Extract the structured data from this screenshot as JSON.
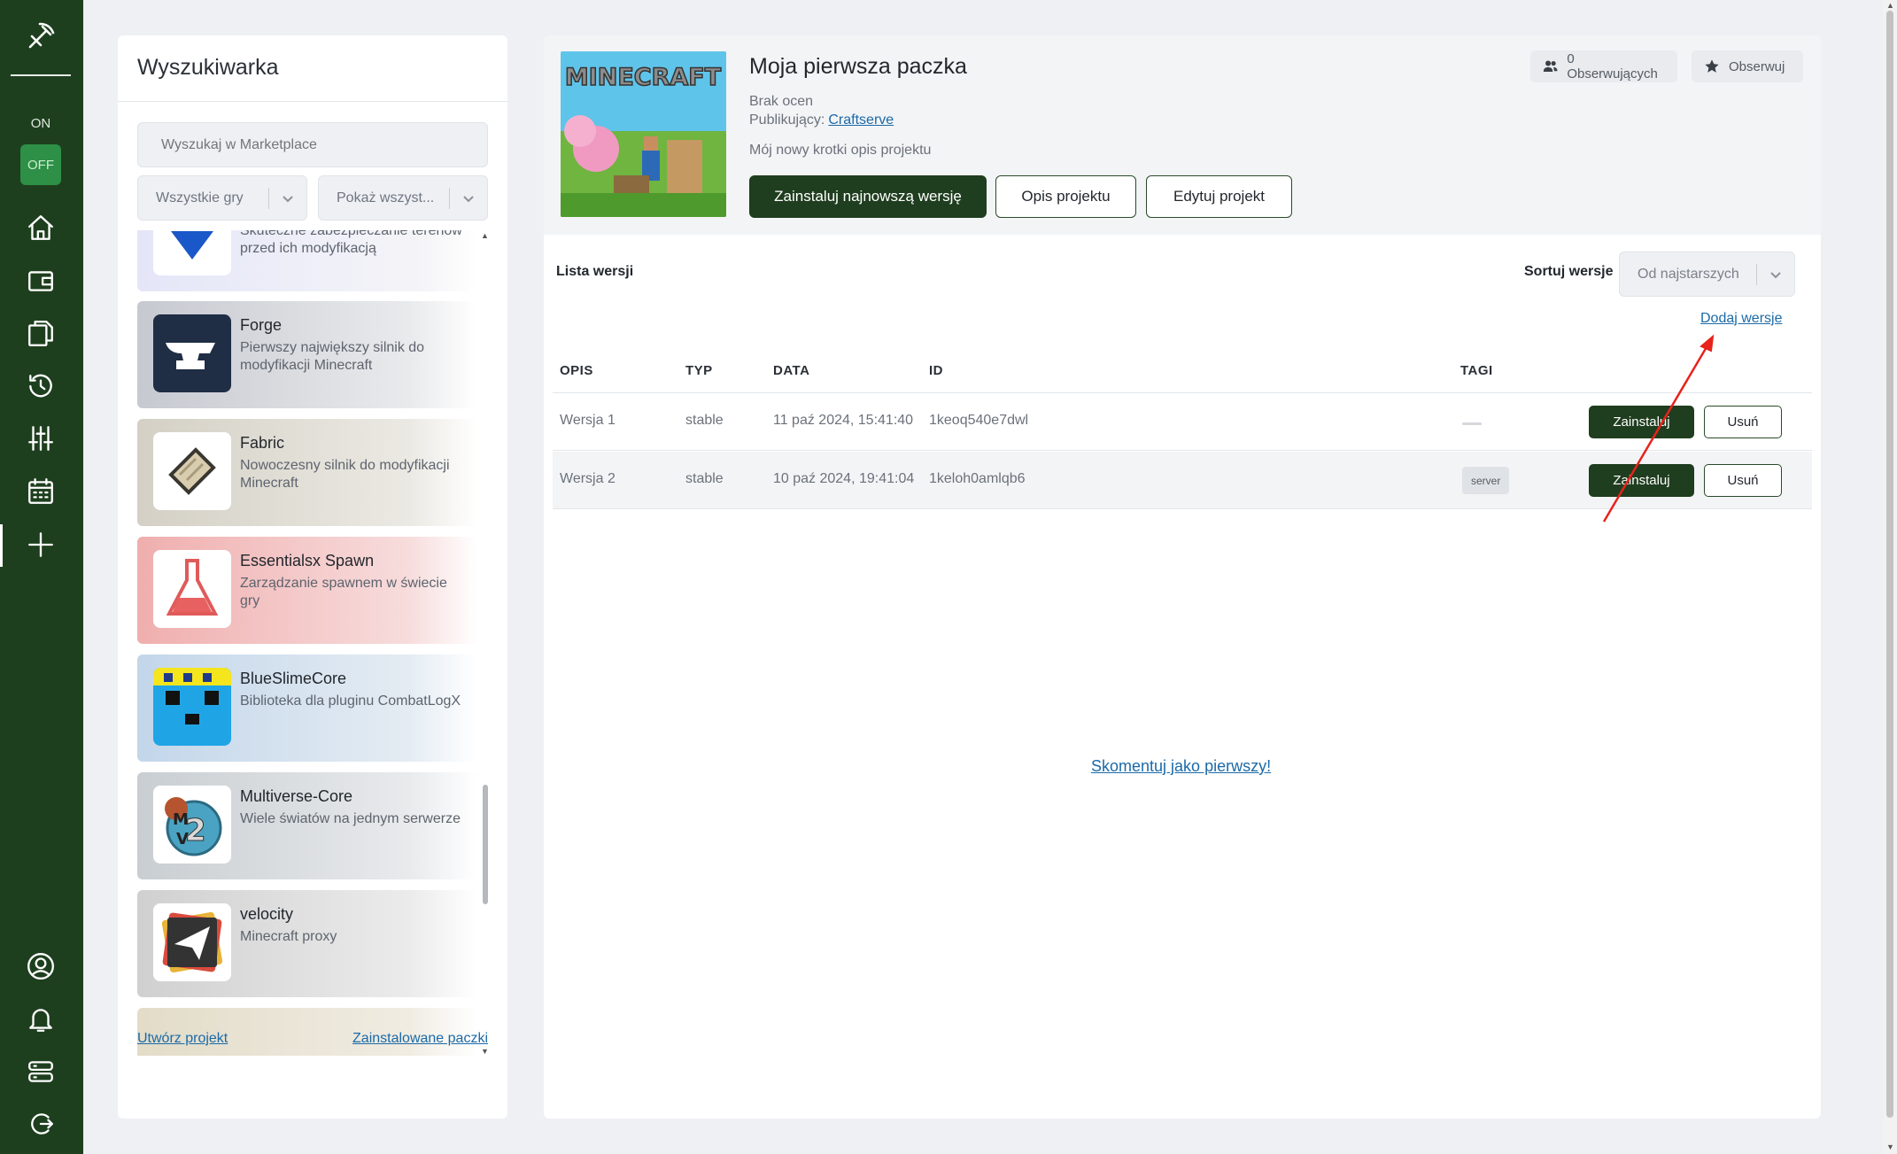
{
  "nav": {
    "toggle_on": "ON",
    "toggle_off": "OFF",
    "colors": {
      "rail": "#1e3f1e",
      "accent": "#2e8f47"
    }
  },
  "search_panel": {
    "title": "Wyszukiwarka",
    "search_placeholder": "Wyszukaj w Marketplace",
    "games_filter": "Wszystkie gry",
    "show_filter": "Pokaż wszyst...",
    "items": [
      {
        "name": "",
        "desc": "Skuteczne zabezpieczanie terenów przed ich modyfikacją",
        "icon": "shield-download-icon",
        "tint": "#e7e9fa"
      },
      {
        "name": "Forge",
        "desc": "Pierwszy największy silnik do modyfikacji Minecraft",
        "icon": "anvil-icon",
        "tint": "#c8cbd2"
      },
      {
        "name": "Fabric",
        "desc": "Nowoczesny silnik do modyfikacji Minecraft",
        "icon": "scroll-icon",
        "tint": "#d6d2c7"
      },
      {
        "name": "Essentialsx Spawn",
        "desc": "Zarządzanie spawnem w świecie gry",
        "icon": "flask-icon",
        "tint": "#f0b3b3"
      },
      {
        "name": "BlueSlimeCore",
        "desc": "Biblioteka dla pluginu CombatLogX",
        "icon": "slime-icon",
        "tint": "#c6d7e8"
      },
      {
        "name": "Multiverse-Core",
        "desc": "Wiele światów na jednym serwerze",
        "icon": "globe-mv2-icon",
        "tint": "#cbd0d4"
      },
      {
        "name": "velocity",
        "desc": "Minecraft proxy",
        "icon": "paper-plane-icon",
        "tint": "#d2d2d2"
      }
    ],
    "create_project": "Utwórz projekt",
    "installed_packages": "Zainstalowane paczki"
  },
  "project": {
    "image_text": "MINECRAFT",
    "title": "Moja pierwsza paczka",
    "rating": "Brak ocen",
    "publisher_label": "Publikujący:",
    "publisher": "Craftserve",
    "description": "Mój nowy krotki opis projektu",
    "btn_install_latest": "Zainstaluj najnowszą wersję",
    "btn_description": "Opis projektu",
    "btn_edit": "Edytuj projekt",
    "followers": "0 Obserwujących",
    "follow": "Obserwuj"
  },
  "versions": {
    "title": "Lista wersji",
    "sort_label": "Sortuj wersje",
    "sort_value": "Od najstarszych",
    "add_version": "Dodaj wersje",
    "columns": {
      "opis": "OPIS",
      "typ": "TYP",
      "data": "DATA",
      "id": "ID",
      "tagi": "TAGI"
    },
    "rows": [
      {
        "opis": "Wersja 1",
        "typ": "stable",
        "data": "11 paź 2024, 15:41:40",
        "id": "1keoq540e7dwl",
        "tag": "",
        "install": "Zainstaluj",
        "remove": "Usuń"
      },
      {
        "opis": "Wersja 2",
        "typ": "stable",
        "data": "10 paź 2024, 19:41:04",
        "id": "1keloh0amlqb6",
        "tag": "server",
        "install": "Zainstaluj",
        "remove": "Usuń"
      }
    ]
  },
  "comments": {
    "first_comment": "Skomentuj jako pierwszy!"
  },
  "annotation": {
    "arrow_color": "#e8221c"
  }
}
